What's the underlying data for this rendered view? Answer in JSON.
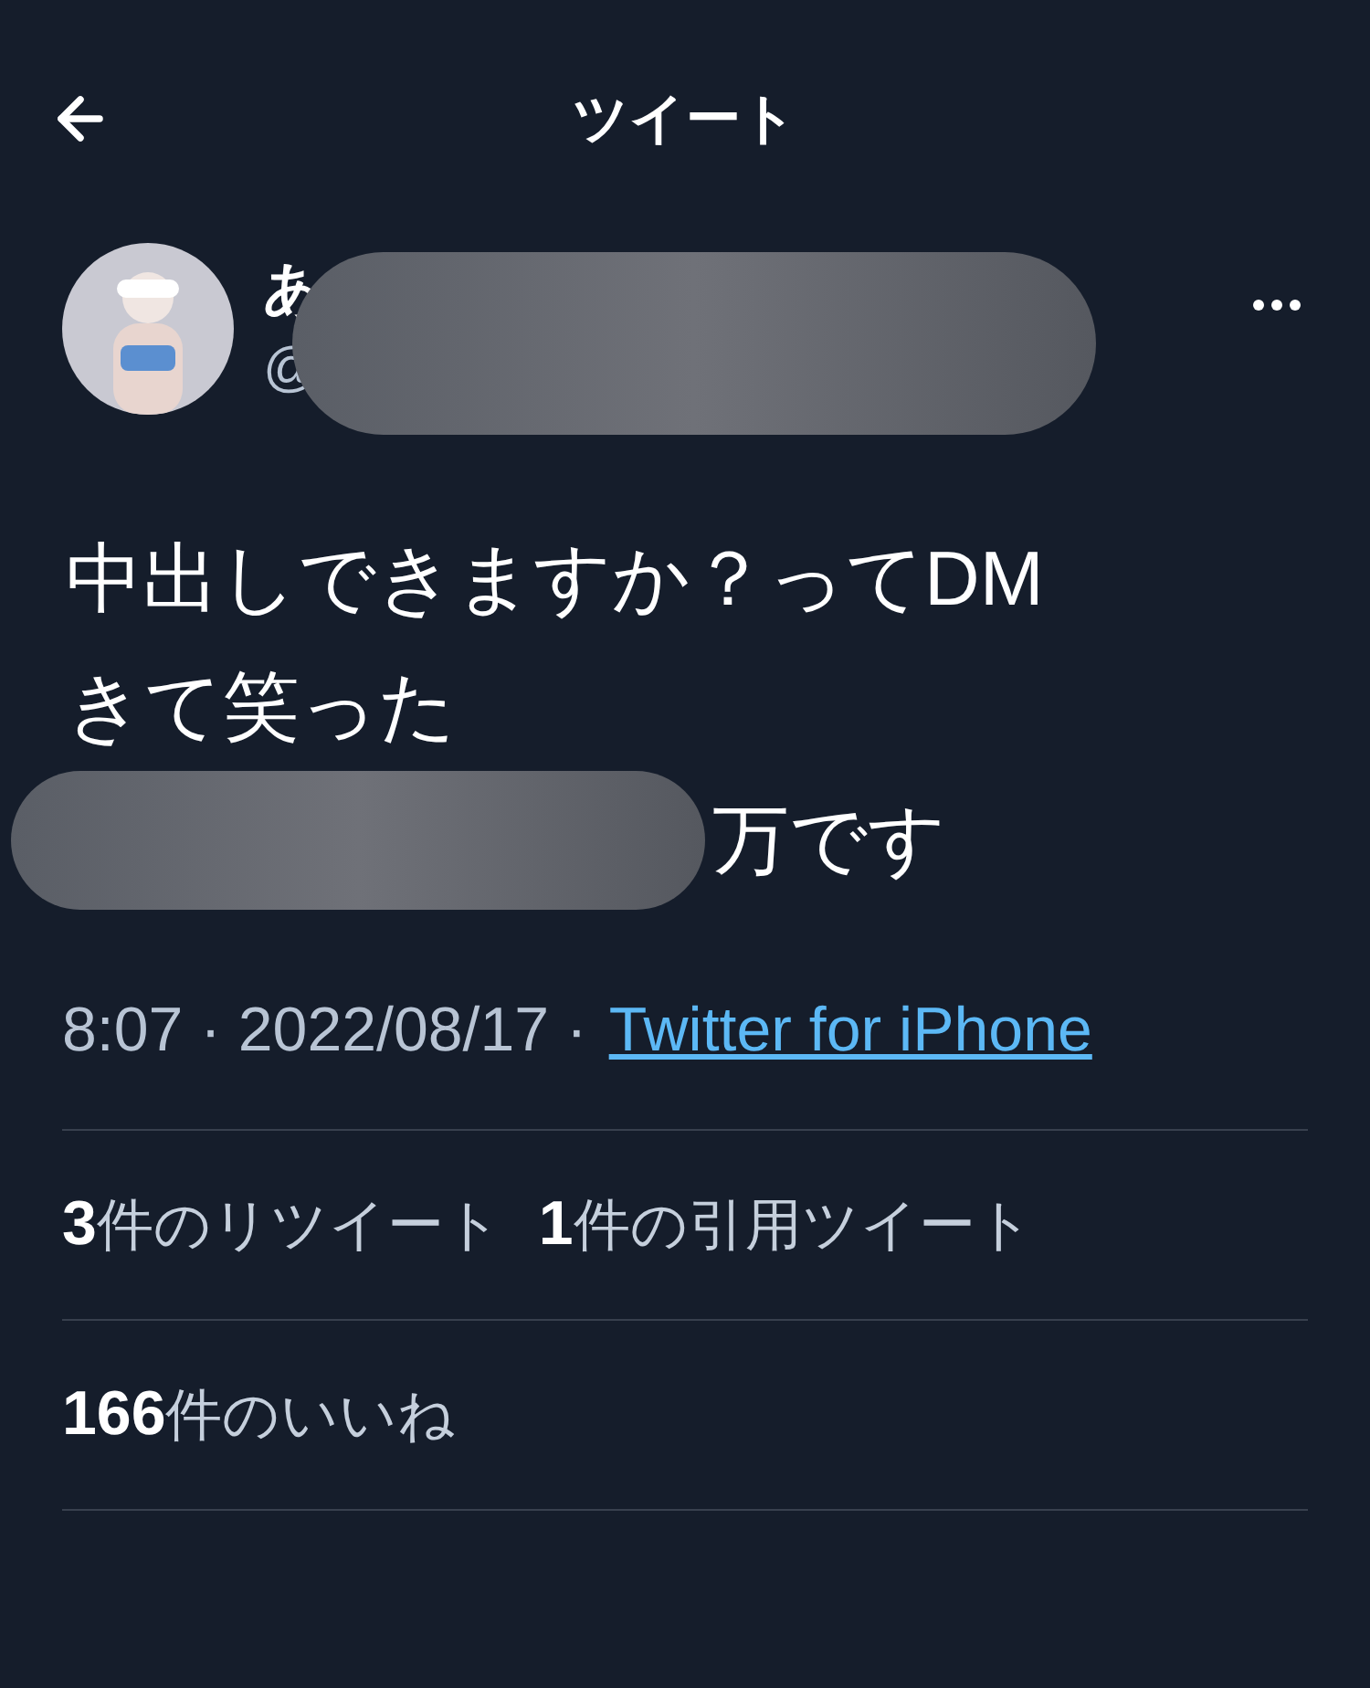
{
  "header": {
    "title": "ツイート"
  },
  "author": {
    "name": "あ",
    "handle": "@"
  },
  "tweet": {
    "lines": [
      "中出しできますか？ってDM",
      "きて笑った",
      "万です"
    ],
    "time": "8:07 · 2022/08/17 ·",
    "source": "Twitter for iPhone"
  },
  "stats_rows": [
    [
      {
        "count": "3",
        "label": "件のリツイート"
      },
      {
        "count": "1",
        "label": "件の引用ツイート"
      }
    ],
    [
      {
        "count": "166",
        "label": "件のいいね"
      }
    ]
  ]
}
